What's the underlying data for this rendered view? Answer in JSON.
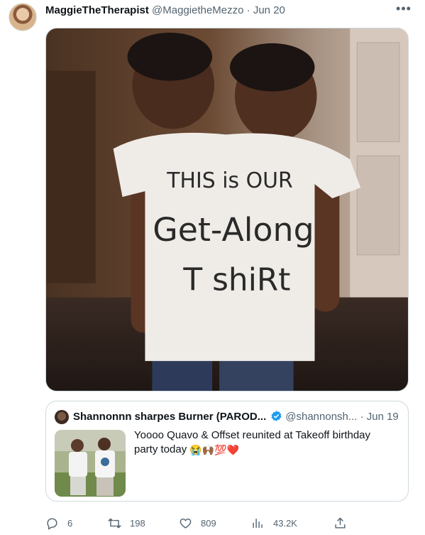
{
  "tweet": {
    "author_name": "MaggieTheTherapist",
    "author_handle": "@MaggietheMezzo",
    "separator": "·",
    "date": "Jun 20",
    "more_icon": "more-horizontal-icon",
    "media": {
      "shirt_text_line1": "THIS is OUR",
      "shirt_text_line2": "Get-Along",
      "shirt_text_line3": "T shiRt"
    }
  },
  "quoted_tweet": {
    "author_name": "Shannonnn sharpes Burner (PAROD...",
    "verified_icon": "verified-badge-icon",
    "author_handle": "@shannonsh...",
    "separator": "·",
    "date": "Jun 19",
    "text": "Yoooo Quavo & Offset reunited at Takeoff birthday party today",
    "emojis": "😭🙌🏾💯❤️"
  },
  "actions": {
    "reply_count": "6",
    "retweet_count": "198",
    "like_count": "809",
    "views_count": "43.2K"
  },
  "colors": {
    "text_primary": "#0f1419",
    "text_secondary": "#536471",
    "border": "#cfd9de",
    "verified_blue": "#1d9bf0"
  }
}
